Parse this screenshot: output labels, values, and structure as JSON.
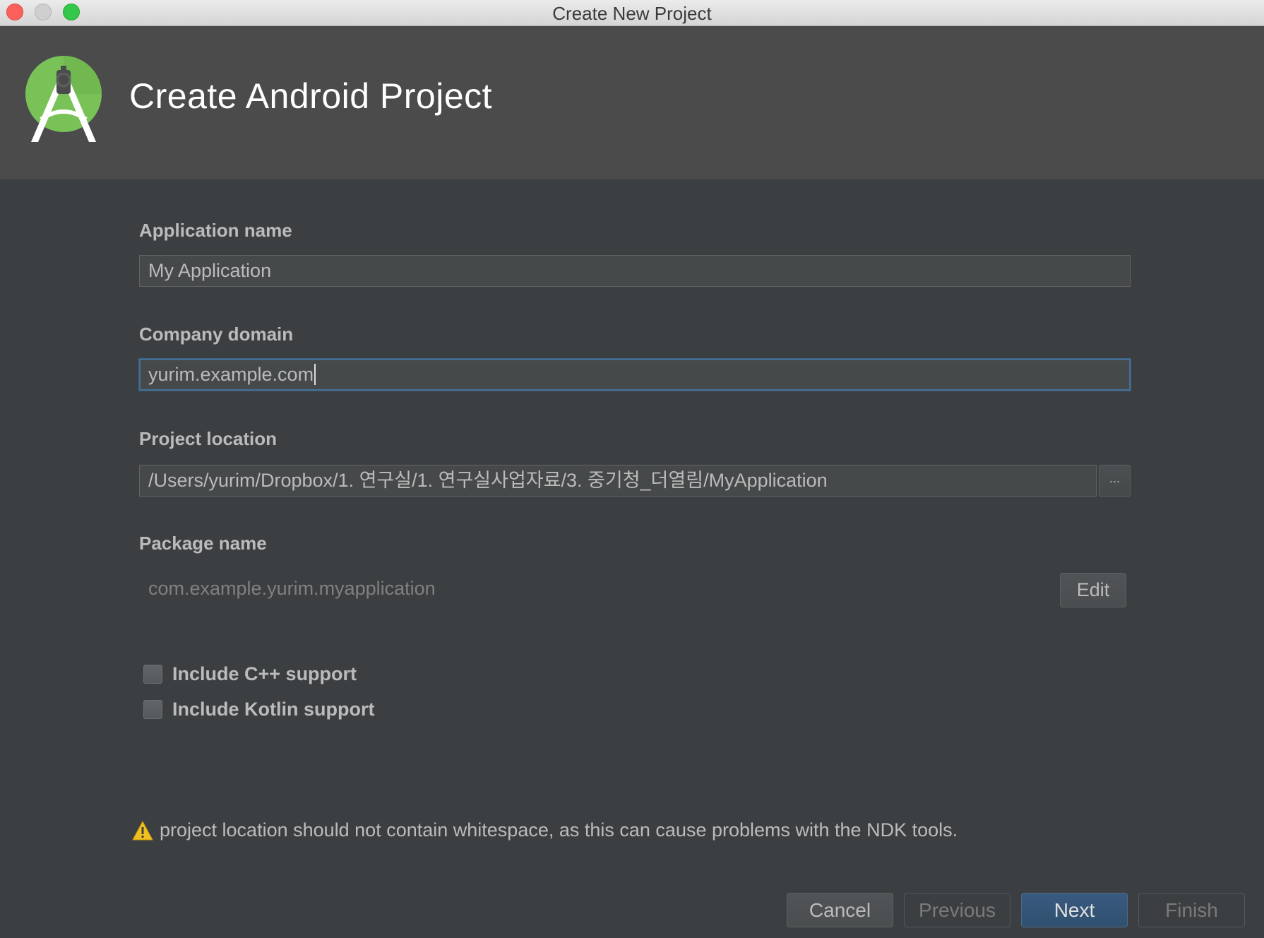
{
  "window": {
    "title": "Create New Project"
  },
  "header": {
    "title": "Create Android Project",
    "logo_icon": "android-studio-logo-icon"
  },
  "form": {
    "app_name_label": "Application name",
    "app_name_value": "My Application",
    "company_domain_label": "Company domain",
    "company_domain_value": "yurim.example.com",
    "project_location_label": "Project location",
    "project_location_value": "/Users/yurim/Dropbox/1. 연구실/1. 연구실사업자료/3. 중기청_더열림/MyApplication",
    "browse_label": "...",
    "package_name_label": "Package name",
    "package_name_value": "com.example.yurim.myapplication",
    "edit_label": "Edit",
    "include_cpp_label": "Include C++ support",
    "include_cpp_checked": false,
    "include_kotlin_label": "Include Kotlin support",
    "include_kotlin_checked": false
  },
  "warning": {
    "icon": "warning-icon",
    "text": "project location should not contain whitespace, as this can cause problems with the NDK tools."
  },
  "footer": {
    "cancel_label": "Cancel",
    "previous_label": "Previous",
    "next_label": "Next",
    "finish_label": "Finish"
  },
  "colors": {
    "background": "#3c3f41",
    "header_background": "#4b4b4b",
    "accent": "#3d6185",
    "warning": "#f0c020",
    "android_green": "#78c257"
  }
}
